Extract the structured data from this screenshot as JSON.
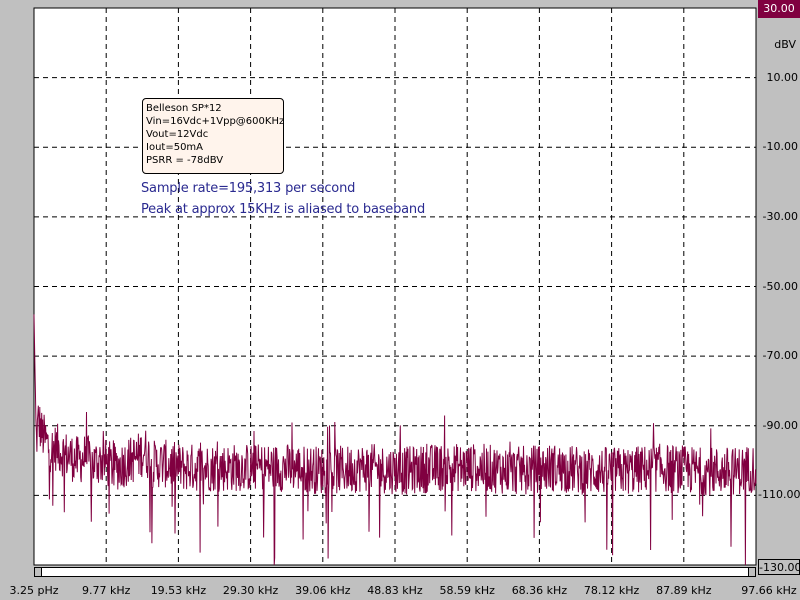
{
  "chart_data": {
    "type": "line",
    "unit": "dBV",
    "y_ticks": [
      "30.00",
      "10.00",
      "-10.00",
      "-30.00",
      "-50.00",
      "-70.00",
      "-90.00",
      "-110.00",
      "-130.00"
    ],
    "y_tick_values": [
      30,
      10,
      -10,
      -30,
      -50,
      -70,
      -90,
      -110,
      -130
    ],
    "ylim": [
      -130,
      30
    ],
    "x_ticks": [
      "3.25 pHz",
      "9.77 kHz",
      "19.53 kHz",
      "29.30 kHz",
      "39.06 kHz",
      "48.83 kHz",
      "58.59 kHz",
      "68.36 kHz",
      "78.12 kHz",
      "87.89 kHz",
      "97.66 kHz"
    ],
    "xlim": [
      0,
      97.66
    ],
    "x_unit_note": "kHz",
    "grid": true,
    "series": [
      {
        "color": "#800040",
        "x": [
          0,
          0.3,
          0.6,
          1,
          1.5,
          2,
          2.5,
          3,
          4,
          5,
          6,
          7,
          8,
          9,
          10,
          11,
          12,
          13,
          14,
          15,
          16,
          18,
          20,
          25,
          30,
          35,
          40,
          45,
          50,
          55,
          60,
          65,
          70,
          75,
          80,
          85,
          90,
          95,
          97.66
        ],
        "y": [
          -58,
          -95,
          -88,
          -92,
          -94,
          -96,
          -97,
          -96,
          -98,
          -99,
          -100,
          -99,
          -101,
          -100,
          -101,
          -102,
          -101,
          -100,
          -99,
          -97,
          -101,
          -101,
          -102,
          -102,
          -102,
          -102,
          -103,
          -102,
          -103,
          -102,
          -102,
          -103,
          -102,
          -103,
          -103,
          -102,
          -103,
          -103,
          -102
        ]
      }
    ],
    "noise_band_dbv": [
      -112,
      -94
    ]
  },
  "legend": {
    "lines": [
      "Belleson SP*12",
      "Vin=16Vdc+1Vpp@600KHz",
      "Vout=12Vdc",
      "Iout=50mA",
      "PSRR = -78dBV"
    ]
  },
  "annotations": [
    "Sample rate=195,313 per second",
    "Peak at approx 15KHz is aliased to baseband"
  ],
  "colors": {
    "trace": "#800040",
    "grid": "#000000",
    "plot_bg": "#ffffff",
    "frame_bg": "#c0c0c0",
    "annotation": "#2a2a90"
  }
}
